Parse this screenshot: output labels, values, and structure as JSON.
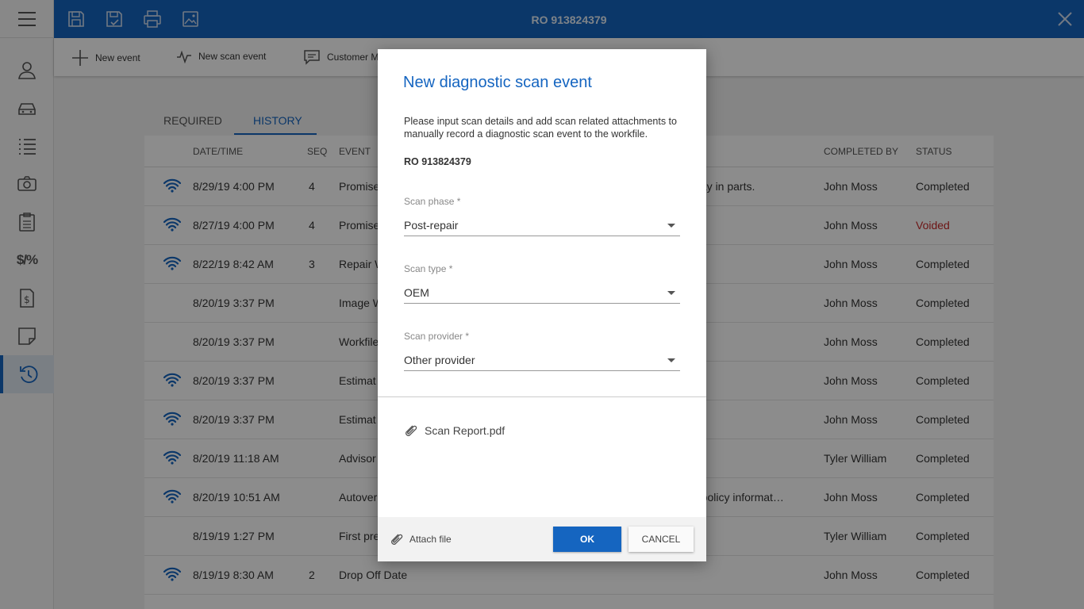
{
  "header": {
    "title": "RO 913824379",
    "icons": [
      "save-icon",
      "save-check-icon",
      "print-icon",
      "image-icon"
    ],
    "close_icon": "close-icon"
  },
  "sidebar": {
    "menu_icon": "hamburger-icon",
    "items": [
      {
        "icon": "person-icon"
      },
      {
        "icon": "car-icon"
      },
      {
        "icon": "list-icon"
      },
      {
        "icon": "camera-icon"
      },
      {
        "icon": "clipboard-icon"
      },
      {
        "icon": "dollar-percent-icon",
        "text": "$/%"
      },
      {
        "icon": "invoice-icon"
      },
      {
        "icon": "note-icon"
      },
      {
        "icon": "history-icon",
        "active": true
      }
    ]
  },
  "toolbar": {
    "new_event": "New event",
    "new_scan_event": "New scan event",
    "customer": "Customer M"
  },
  "tabs": [
    "REQUIRED",
    "HISTORY"
  ],
  "table": {
    "headers": {
      "datetime": "DATE/TIME",
      "seq": "SEQ",
      "event": "EVENT",
      "completed_by": "COMPLETED BY",
      "status": "STATUS"
    },
    "rows": [
      {
        "wifi": true,
        "datetime": "8/29/19 4:00 PM",
        "seq": "4",
        "event": "Promise",
        "extra": "elay in parts.",
        "completed_by": "John Moss",
        "status": "Completed"
      },
      {
        "wifi": true,
        "datetime": "8/27/19 4:00 PM",
        "seq": "4",
        "event": "Promise",
        "extra": "",
        "completed_by": "John Moss",
        "status": "Voided"
      },
      {
        "wifi": true,
        "datetime": "8/22/19 8:42 AM",
        "seq": "3",
        "event": "Repair W",
        "extra": "",
        "completed_by": "John Moss",
        "status": "Completed"
      },
      {
        "wifi": false,
        "datetime": "8/20/19 3:37 PM",
        "seq": "",
        "event": "Image W",
        "extra": "",
        "completed_by": "John Moss",
        "status": "Completed"
      },
      {
        "wifi": false,
        "datetime": "8/20/19 3:37 PM",
        "seq": "",
        "event": "Workfile",
        "extra": "",
        "completed_by": "John Moss",
        "status": "Completed"
      },
      {
        "wifi": true,
        "datetime": "8/20/19 3:37 PM",
        "seq": "",
        "event": "Estimat",
        "extra": "",
        "completed_by": "John Moss",
        "status": "Completed"
      },
      {
        "wifi": true,
        "datetime": "8/20/19 3:37 PM",
        "seq": "",
        "event": "Estimat",
        "extra": "",
        "completed_by": "John Moss",
        "status": "Completed"
      },
      {
        "wifi": true,
        "datetime": "8/20/19 11:18 AM",
        "seq": "",
        "event": "Advisor",
        "extra": "",
        "completed_by": "Tyler William",
        "status": "Completed"
      },
      {
        "wifi": true,
        "datetime": "8/20/19 10:51 AM",
        "seq": "",
        "event": "Autover",
        "extra": "d policy informat…",
        "completed_by": "John Moss",
        "status": "Completed"
      },
      {
        "wifi": false,
        "datetime": "8/19/19 1:27 PM",
        "seq": "",
        "event": "First pre",
        "extra": "",
        "completed_by": "Tyler William",
        "status": "Completed"
      },
      {
        "wifi": true,
        "datetime": "8/19/19 8:30 AM",
        "seq": "2",
        "event": "Drop Off Date",
        "extra": "",
        "completed_by": "John Moss",
        "status": "Completed"
      }
    ]
  },
  "dialog": {
    "title": "New diagnostic scan event",
    "description": "Please input scan details and add scan related attachments to manually record a diagnostic scan event to the workfile.",
    "ro": "RO 913824379",
    "scan_phase": {
      "label": "Scan phase *",
      "value": "Post-repair"
    },
    "scan_type": {
      "label": "Scan type *",
      "value": "OEM"
    },
    "scan_provider": {
      "label": "Scan provider *",
      "value": "Other provider"
    },
    "attachment": "Scan Report.pdf",
    "attach_file": "Attach file",
    "ok": "OK",
    "cancel": "CANCEL"
  },
  "colors": {
    "primary": "#1565c0",
    "voided": "#c62828"
  }
}
